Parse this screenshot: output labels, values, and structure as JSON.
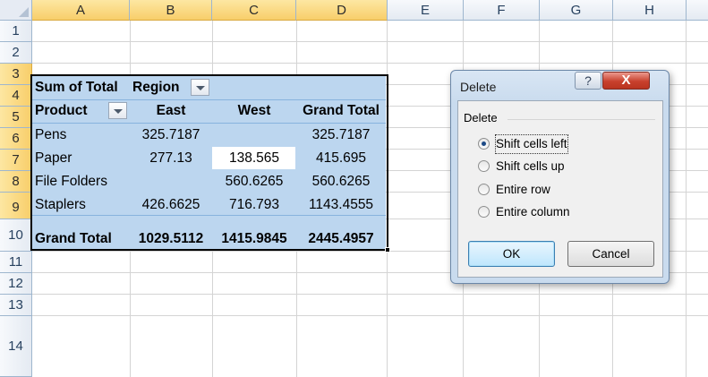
{
  "sheet": {
    "columns": [
      "A",
      "B",
      "C",
      "D",
      "E",
      "F",
      "G",
      "H"
    ],
    "rows": [
      "1",
      "2",
      "3",
      "4",
      "5",
      "6",
      "7",
      "8",
      "9",
      "10",
      "11",
      "12",
      "13",
      "14"
    ],
    "selected_columns": [
      "A",
      "B",
      "C",
      "D"
    ],
    "selected_rows": [
      "3",
      "4",
      "5",
      "6",
      "7",
      "8",
      "9"
    ]
  },
  "pivot": {
    "values_label": "Sum of Total",
    "column_field": "Region",
    "row_field": "Product",
    "column_headers": [
      "East",
      "West",
      "Grand Total"
    ],
    "rows": [
      {
        "label": "Pens",
        "east": "325.7187",
        "west": "",
        "total": "325.7187"
      },
      {
        "label": "Paper",
        "east": "277.13",
        "west": "138.565",
        "total": "415.695"
      },
      {
        "label": "File Folders",
        "east": "",
        "west": "560.6265",
        "total": "560.6265"
      },
      {
        "label": "Staplers",
        "east": "426.6625",
        "west": "716.793",
        "total": "1143.4555"
      }
    ],
    "grand_total": {
      "label": "Grand Total",
      "east": "1029.5112",
      "west": "1415.9845",
      "total": "2445.4957"
    }
  },
  "dialog": {
    "title": "Delete",
    "help_label": "?",
    "close_label": "X",
    "group_label": "Delete",
    "options": [
      {
        "label": "Shift cells left",
        "checked": true
      },
      {
        "label": "Shift cells up",
        "checked": false
      },
      {
        "label": "Entire row",
        "checked": false
      },
      {
        "label": "Entire column",
        "checked": false
      }
    ],
    "ok_label": "OK",
    "cancel_label": "Cancel"
  },
  "colors": {
    "pivot_fill": "#bcd6ef",
    "header_selected": "#f8ce6a",
    "close_button": "#c8402d"
  }
}
